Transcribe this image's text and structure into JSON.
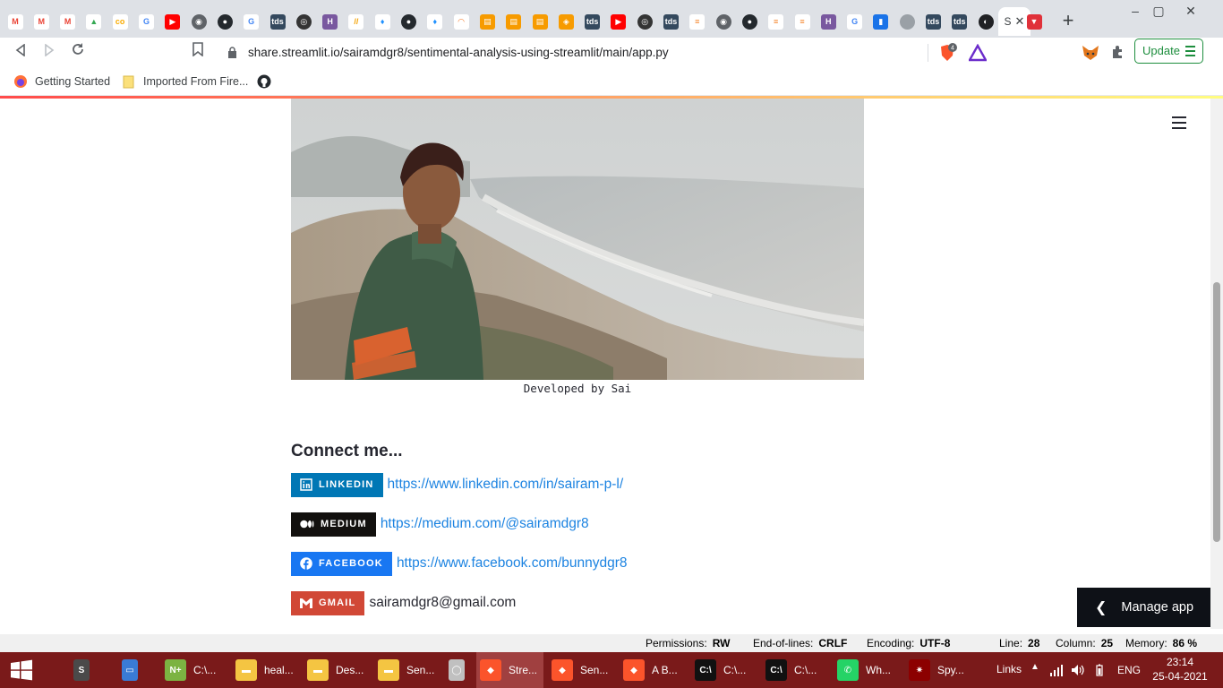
{
  "browser": {
    "tab_favicons": [
      "gmail",
      "gmail",
      "gmail",
      "google-drive",
      "colab",
      "google",
      "youtube",
      "globe",
      "github",
      "google",
      "tds",
      "circleci",
      "heroku",
      "streamlit",
      "streamlit-app",
      "github",
      "streamlit-app",
      "crunchyroll",
      "orange-doc",
      "orange-doc",
      "orange-doc",
      "streamlit-orange",
      "tds",
      "youtube",
      "circleci",
      "tds",
      "stackoverflow",
      "globe",
      "github",
      "stackoverflow",
      "stackoverflow",
      "heroku",
      "google",
      "chart",
      "grey-circle",
      "tds",
      "tds",
      "dark-round"
    ],
    "active_tab_label": "S",
    "active_tab_favicon_color": "#e0313a",
    "new_tab_label": "+",
    "url": "share.streamlit.io/sairamdgr8/sentimental-analysis-using-streamlit/main/app.py",
    "update_button_label": "Update",
    "brave_badge_count": "4",
    "bookmarks": [
      {
        "label": "Getting Started",
        "icon": "firefox-icon"
      },
      {
        "label": "Imported From Fire...",
        "icon": "folder-icon"
      },
      {
        "label": "",
        "icon": "github-icon"
      }
    ]
  },
  "page": {
    "caption": "Developed by Sai",
    "connect_heading": "Connect me...",
    "socials": [
      {
        "badge": "LINKEDIN",
        "text": "https://www.linkedin.com/in/sairam-p-l/",
        "color": "#0077b5",
        "icon": "linkedin-icon",
        "is_link": true
      },
      {
        "badge": "MEDIUM",
        "text": "https://medium.com/@sairamdgr8",
        "color": "#12100e",
        "icon": "medium-icon",
        "is_link": true
      },
      {
        "badge": "FACEBOOK",
        "text": "https://www.facebook.com/bunnydgr8",
        "color": "#1877f2",
        "icon": "facebook-icon",
        "is_link": true
      },
      {
        "badge": "GMAIL",
        "text": "sairamdgr8@gmail.com",
        "color": "#d14836",
        "icon": "gmail-icon",
        "is_link": false
      }
    ],
    "manage_app_label": "Manage app"
  },
  "statusbar": {
    "permissions_label": "Permissions:",
    "permissions_value": "RW",
    "eol_label": "End-of-lines:",
    "eol_value": "CRLF",
    "encoding_label": "Encoding:",
    "encoding_value": "UTF-8",
    "line_label": "Line:",
    "line_value": "28",
    "column_label": "Column:",
    "column_value": "25",
    "memory_label": "Memory:",
    "memory_value": "86 %"
  },
  "taskbar": {
    "items": [
      {
        "label": "",
        "icon": "sublime-icon",
        "color": "#4a4a4a"
      },
      {
        "label": "",
        "icon": "window-icon",
        "color": "#3a7bd5"
      },
      {
        "label": "C:\\...",
        "icon": "notepad-plus-icon",
        "color": "#7cb342"
      },
      {
        "label": "heal...",
        "icon": "folder-icon",
        "color": "#f4c542"
      },
      {
        "label": "Des...",
        "icon": "folder-doc-icon",
        "color": "#f4c542"
      },
      {
        "label": "Sen...",
        "icon": "folder-icon",
        "color": "#f4c542"
      },
      {
        "label": "",
        "icon": "anaconda-icon",
        "color": "#c0c0c0"
      },
      {
        "label": "Stre...",
        "icon": "brave-icon",
        "color": "#fb542b"
      },
      {
        "label": "Sen...",
        "icon": "brave-icon",
        "color": "#fb542b"
      },
      {
        "label": "A B...",
        "icon": "brave-icon",
        "color": "#fb542b"
      },
      {
        "label": "C:\\...",
        "icon": "cmd-icon",
        "color": "#111"
      },
      {
        "label": "C:\\...",
        "icon": "cmd-icon",
        "color": "#111"
      },
      {
        "label": "Wh...",
        "icon": "whatsapp-icon",
        "color": "#25d366"
      },
      {
        "label": "Spy...",
        "icon": "spyder-icon",
        "color": "#8c0000"
      }
    ],
    "links_label": "Links",
    "language": "ENG",
    "time": "23:14",
    "date": "25-04-2021"
  }
}
